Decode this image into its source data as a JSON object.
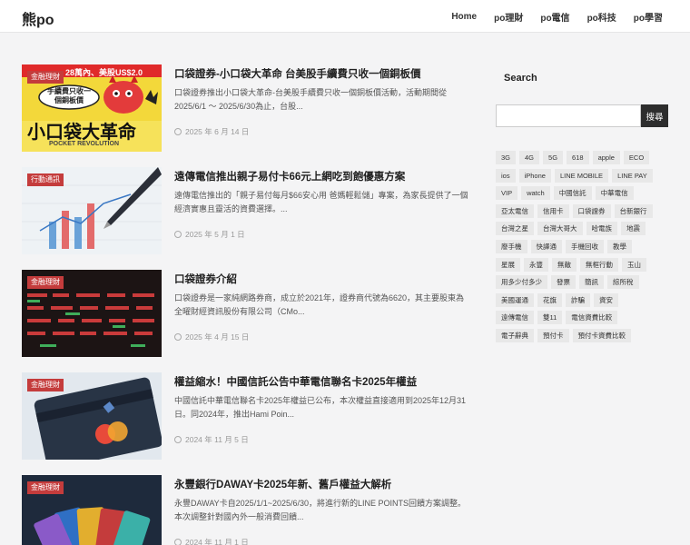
{
  "site": {
    "logo": "熊po"
  },
  "nav": [
    "Home",
    "po理財",
    "po電信",
    "po科技",
    "po學習"
  ],
  "posts": [
    {
      "category": "金融理財",
      "title": "口袋證券-小口袋大革命 台美股手續費只收一個銅板價",
      "excerpt": "口袋證券推出小口袋大革命-台美股手續費只收一個銅板價活動，活動期間從2025/6/1 ～ 2025/6/30為止，台股...",
      "date": "2025 年 6 月 14 日",
      "thumb_texts": {
        "banner": "28萬內、美股US$2.0",
        "bubble": "手續費只收一個銅板價",
        "big": "小口袋大革命",
        "sub": "POCKET REVOLUTION"
      }
    },
    {
      "category": "行動通訊",
      "title": "遠傳電信推出親子易付卡66元上網吃到飽優惠方案",
      "excerpt": "遠傳電信推出的「親子易付每月$66安心用 爸媽輕鬆儲」專案，為家長提供了一個經濟實惠且靈活的資費選擇。...",
      "date": "2025 年 5 月 1 日"
    },
    {
      "category": "金融理財",
      "title": "口袋證券介紹",
      "excerpt": "口袋證券是一家純網路券商，成立於2021年，證券商代號為6620，其主要股東為全曜財經資訊股份有限公司（CMo...",
      "date": "2025 年 4 月 15 日"
    },
    {
      "category": "金融理財",
      "title": "權益縮水！中國信託公告中華電信聯名卡2025年權益",
      "excerpt": "中國信託中華電信聯名卡2025年權益已公布，本次權益直接適用到2025年12月31日。同2024年，推出Hami Poin...",
      "date": "2024 年 11 月 5 日"
    },
    {
      "category": "金融理財",
      "title": "永豐銀行DAWAY卡2025年新、舊戶權益大解析",
      "excerpt": "永豐DAWAY卡自2025/1/1~2025/6/30，將進行新的LINE POINTS回饋方案調整。本次調整針對國內外一般消費回饋...",
      "date": "2024 年 11 月 1 日"
    }
  ],
  "sidebar": {
    "search_title": "Search",
    "search_placeholder": "",
    "search_button": "搜尋",
    "tag_rows": [
      [
        "3G",
        "4G",
        "5G",
        "618",
        "apple",
        "ECO"
      ],
      [
        "ios",
        "iPhone",
        "LINE MOBILE",
        "LINE PAY"
      ],
      [
        "VIP",
        "watch",
        "中國信託",
        "中華電信"
      ],
      [
        "亞太電信",
        "信用卡",
        "口袋證券",
        "台新銀行"
      ],
      [
        "台灣之星",
        "台灣大哥大",
        "哈電族",
        "地震"
      ],
      [
        "廢手機",
        "快譯通",
        "手機回收",
        "教學"
      ],
      [
        "星展",
        "永豐",
        "無敵",
        "無框行動",
        "玉山"
      ],
      [
        "用多少付多少",
        "發票",
        "簡訊",
        "綜所稅"
      ],
      [
        "美國運通",
        "花旗",
        "詐騙",
        "資安"
      ],
      [
        "遠傳電信",
        "雙11",
        "電信資費比較"
      ],
      [
        "電子辭典",
        "預付卡",
        "預付卡資費比較"
      ]
    ]
  },
  "colors": {
    "badge": "#c43c3c",
    "accent_dark": "#2d2d2d",
    "background": "#f4f4f5"
  }
}
